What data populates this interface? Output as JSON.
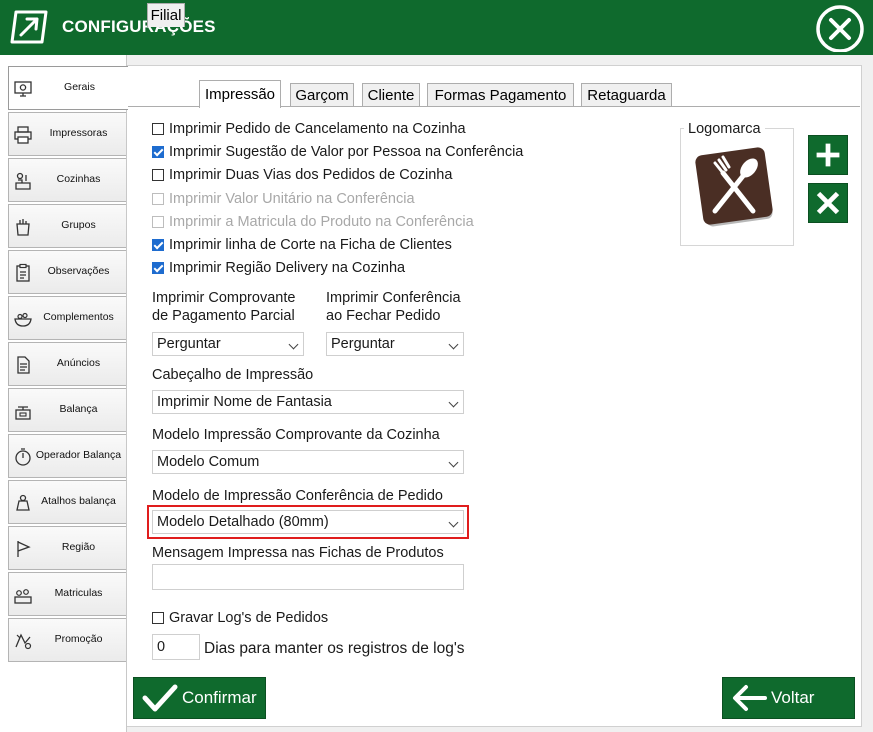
{
  "window": {
    "title": "CONFIGURAÇÕES",
    "close_icon": "close-circle-icon"
  },
  "sidebar": {
    "items": [
      {
        "label": "Gerais",
        "icon": "settings-monitor-icon",
        "active": true
      },
      {
        "label": "Impressoras",
        "icon": "printer-icon"
      },
      {
        "label": "Cozinhas",
        "icon": "kitchen-icon"
      },
      {
        "label": "Grupos",
        "icon": "groups-icon"
      },
      {
        "label": "Observações",
        "icon": "clipboard-icon"
      },
      {
        "label": "Complementos",
        "icon": "food-bowl-icon"
      },
      {
        "label": "Anúncios",
        "icon": "document-icon"
      },
      {
        "label": "Balança",
        "icon": "scale-icon"
      },
      {
        "label": "Operador  Balança",
        "icon": "stopwatch-icon"
      },
      {
        "label": "Atalhos balança",
        "icon": "scale-shortcut-icon"
      },
      {
        "label": "Região",
        "icon": "flag-icon"
      },
      {
        "label": "Matriculas",
        "icon": "registration-icon"
      },
      {
        "label": "Promoção",
        "icon": "promotion-icon"
      }
    ]
  },
  "tabs": [
    {
      "label": "Filial"
    },
    {
      "label": "Impressão",
      "active": true
    },
    {
      "label": "Garçom"
    },
    {
      "label": "Cliente"
    },
    {
      "label": "Formas Pagamento"
    },
    {
      "label": "Retaguarda"
    }
  ],
  "checkboxes": [
    {
      "label": "Imprimir Pedido de Cancelamento na Cozinha",
      "checked": false,
      "disabled": false
    },
    {
      "label": "Imprimir Sugestão de Valor por Pessoa na Conferência",
      "checked": true,
      "disabled": false
    },
    {
      "label": "Imprimir Duas Vias dos Pedidos de Cozinha",
      "checked": false,
      "disabled": false
    },
    {
      "label": "Imprimir Valor Unitário na Conferência",
      "checked": false,
      "disabled": true
    },
    {
      "label": "Imprimir a Matricula do Produto na Conferência",
      "checked": false,
      "disabled": true
    },
    {
      "label": "Imprimir linha de Corte na Ficha de Clientes",
      "checked": true,
      "disabled": false
    },
    {
      "label": "Imprimir Região Delivery na Cozinha",
      "checked": true,
      "disabled": false
    }
  ],
  "comprovante_parcial": {
    "label_line1": "Imprimir Comprovante",
    "label_line2": "de Pagamento Parcial",
    "value": "Perguntar"
  },
  "conferencia_fechar": {
    "label_line1": "Imprimir Conferência",
    "label_line2": "ao Fechar Pedido",
    "value": "Perguntar"
  },
  "cabecalho": {
    "label": "Cabeçalho de Impressão",
    "value": "Imprimir Nome de Fantasia"
  },
  "modelo_cozinha": {
    "label": "Modelo Impressão Comprovante da Cozinha",
    "value": "Modelo Comum"
  },
  "modelo_conferencia": {
    "label": "Modelo de Impressão Conferência de Pedido",
    "value": "Modelo Detalhado (80mm)"
  },
  "mensagem_fichas": {
    "label": "Mensagem Impressa nas Fichas de Produtos",
    "value": ""
  },
  "gravar_log": {
    "label": "Gravar Log's de Pedidos",
    "checked": false
  },
  "dias_log": {
    "value": "0",
    "label": "Dias para manter os registros de log's"
  },
  "logomarca": {
    "label": "Logomarca",
    "image_icon": "fork-spoon-icon",
    "add_icon": "plus-icon",
    "remove_icon": "x-icon"
  },
  "buttons": {
    "confirm": "Confirmar",
    "back": "Voltar"
  },
  "colors": {
    "brand_green": "#0f6a2d",
    "checkbox_blue": "#1e6ccf",
    "highlight_red": "#e01d1d",
    "logo_brown": "#4a2e24"
  }
}
